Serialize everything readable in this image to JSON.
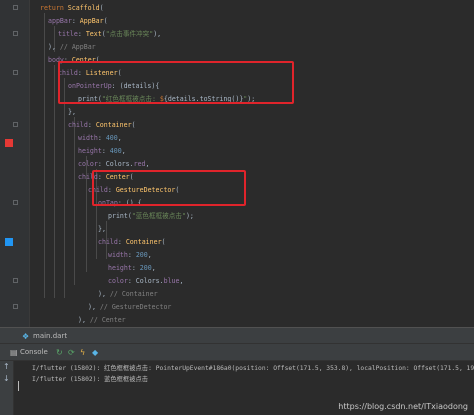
{
  "editor": {
    "lines": [
      "return Scaffold(",
      "appBar: AppBar(",
      "title: Text(\"点击事件冲突\"),",
      "), // AppBar",
      "body: Center(",
      "child: Listener(",
      "onPointerUp: (details){",
      "print(\"红色框框被点击: ${details.toString()}\");",
      "},",
      "child: Container(",
      "width: 400,",
      "height: 400,",
      "color: Colors.red,",
      "child: Center(",
      "child: GestureDetector(",
      "onTap: () {",
      "print(\"蓝色框框被点击\");",
      "},",
      "child: Container(",
      "width: 200,",
      "height: 200,",
      "color: Colors.blue,",
      "), // Container",
      "), // GestureDetector",
      "), // Center",
      "), // Container, Listener",
      "), // Center, Scaffold"
    ],
    "red_swatch": "#e53935",
    "blue_swatch": "#2196f3",
    "highlight_color": "#e0242b"
  },
  "tab": {
    "label": "main.dart",
    "icon": "dart-file-icon"
  },
  "console_toolbar": {
    "console_label": "Console"
  },
  "console": {
    "lines": [
      "I/flutter (15802): 红色框框被点击: PointerUpEvent#186a0(position: Offset(171.5, 353.8), localPosition: Offset(171.5, 192.8), pointer: 7)",
      "I/flutter (15802): 蓝色框框被点击"
    ]
  },
  "watermark": "https://blog.csdn.net/ITxiaodong"
}
